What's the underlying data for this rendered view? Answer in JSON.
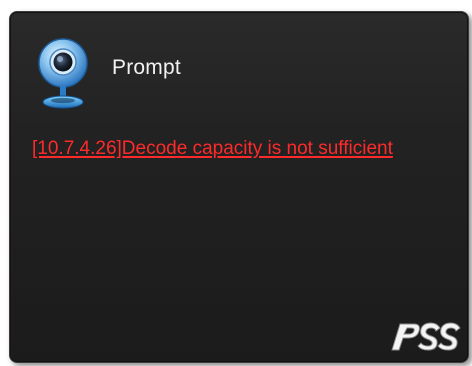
{
  "dialog": {
    "title": "Prompt",
    "message": "[10.7.4.26]Decode capacity is not sufficient",
    "icon": "webcam-icon",
    "logo": "PSS",
    "colors": {
      "background": "#222222",
      "title_text": "#f2f2f2",
      "error_text": "#ff2a2a"
    }
  }
}
